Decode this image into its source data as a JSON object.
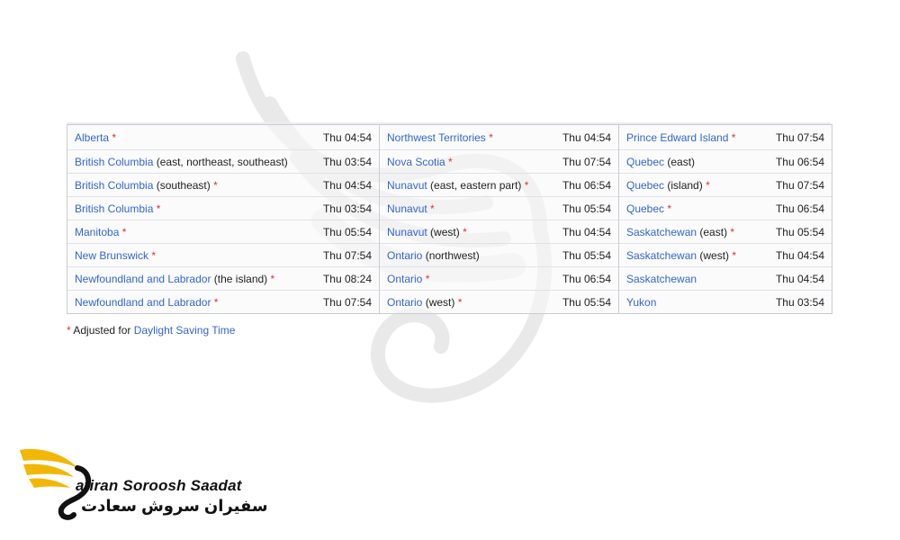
{
  "columns": [
    {
      "rows": [
        {
          "place": "Alberta",
          "note": "",
          "star": "*",
          "time": "Thu 04:54"
        },
        {
          "place": "British Columbia",
          "note": "(east, northeast, southeast)",
          "star": "",
          "time": "Thu 03:54"
        },
        {
          "place": "British Columbia",
          "note": "(southeast)",
          "star": "*",
          "time": "Thu 04:54"
        },
        {
          "place": "British Columbia",
          "note": "",
          "star": "*",
          "time": "Thu 03:54"
        },
        {
          "place": "Manitoba",
          "note": "",
          "star": "*",
          "time": "Thu 05:54"
        },
        {
          "place": "New Brunswick",
          "note": "",
          "star": "*",
          "time": "Thu 07:54"
        },
        {
          "place": "Newfoundland and Labrador",
          "note": "(the island)",
          "star": "*",
          "time": "Thu 08:24"
        },
        {
          "place": "Newfoundland and Labrador",
          "note": "",
          "star": "*",
          "time": "Thu 07:54"
        }
      ]
    },
    {
      "rows": [
        {
          "place": "Northwest Territories",
          "note": "",
          "star": "*",
          "time": "Thu 04:54"
        },
        {
          "place": "Nova Scotia",
          "note": "",
          "star": "*",
          "time": "Thu 07:54"
        },
        {
          "place": "Nunavut",
          "note": "(east, eastern part)",
          "star": "*",
          "time": "Thu 06:54"
        },
        {
          "place": "Nunavut",
          "note": "",
          "star": "*",
          "time": "Thu 05:54"
        },
        {
          "place": "Nunavut",
          "note": "(west)",
          "star": "*",
          "time": "Thu 04:54"
        },
        {
          "place": "Ontario",
          "note": "(northwest)",
          "star": "",
          "time": "Thu 05:54"
        },
        {
          "place": "Ontario",
          "note": "",
          "star": "*",
          "time": "Thu 06:54"
        },
        {
          "place": "Ontario",
          "note": "(west)",
          "star": "*",
          "time": "Thu 05:54"
        }
      ]
    },
    {
      "rows": [
        {
          "place": "Prince Edward Island",
          "note": "",
          "star": "*",
          "time": "Thu 07:54"
        },
        {
          "place": "Quebec",
          "note": "(east)",
          "star": "",
          "time": "Thu 06:54"
        },
        {
          "place": "Quebec",
          "note": "(island)",
          "star": "*",
          "time": "Thu 07:54"
        },
        {
          "place": "Quebec",
          "note": "",
          "star": "*",
          "time": "Thu 06:54"
        },
        {
          "place": "Saskatchewan",
          "note": "(east)",
          "star": "*",
          "time": "Thu 05:54"
        },
        {
          "place": "Saskatchewan",
          "note": "(west)",
          "star": "*",
          "time": "Thu 04:54"
        },
        {
          "place": "Saskatchewan",
          "note": "",
          "star": "",
          "time": "Thu 04:54"
        },
        {
          "place": "Yukon",
          "note": "",
          "star": "",
          "time": "Thu 03:54"
        }
      ]
    }
  ],
  "footnote": {
    "star": "*",
    "text": "Adjusted for",
    "link": "Daylight Saving Time"
  },
  "logo": {
    "latin": "afiran Soroosh Saadat",
    "persian": "سفیران سروش سعادت"
  },
  "colors": {
    "link": "#3366cc",
    "star": "#dd3333",
    "border": "#c8ccd1",
    "logo_gold": "#f2b705"
  }
}
